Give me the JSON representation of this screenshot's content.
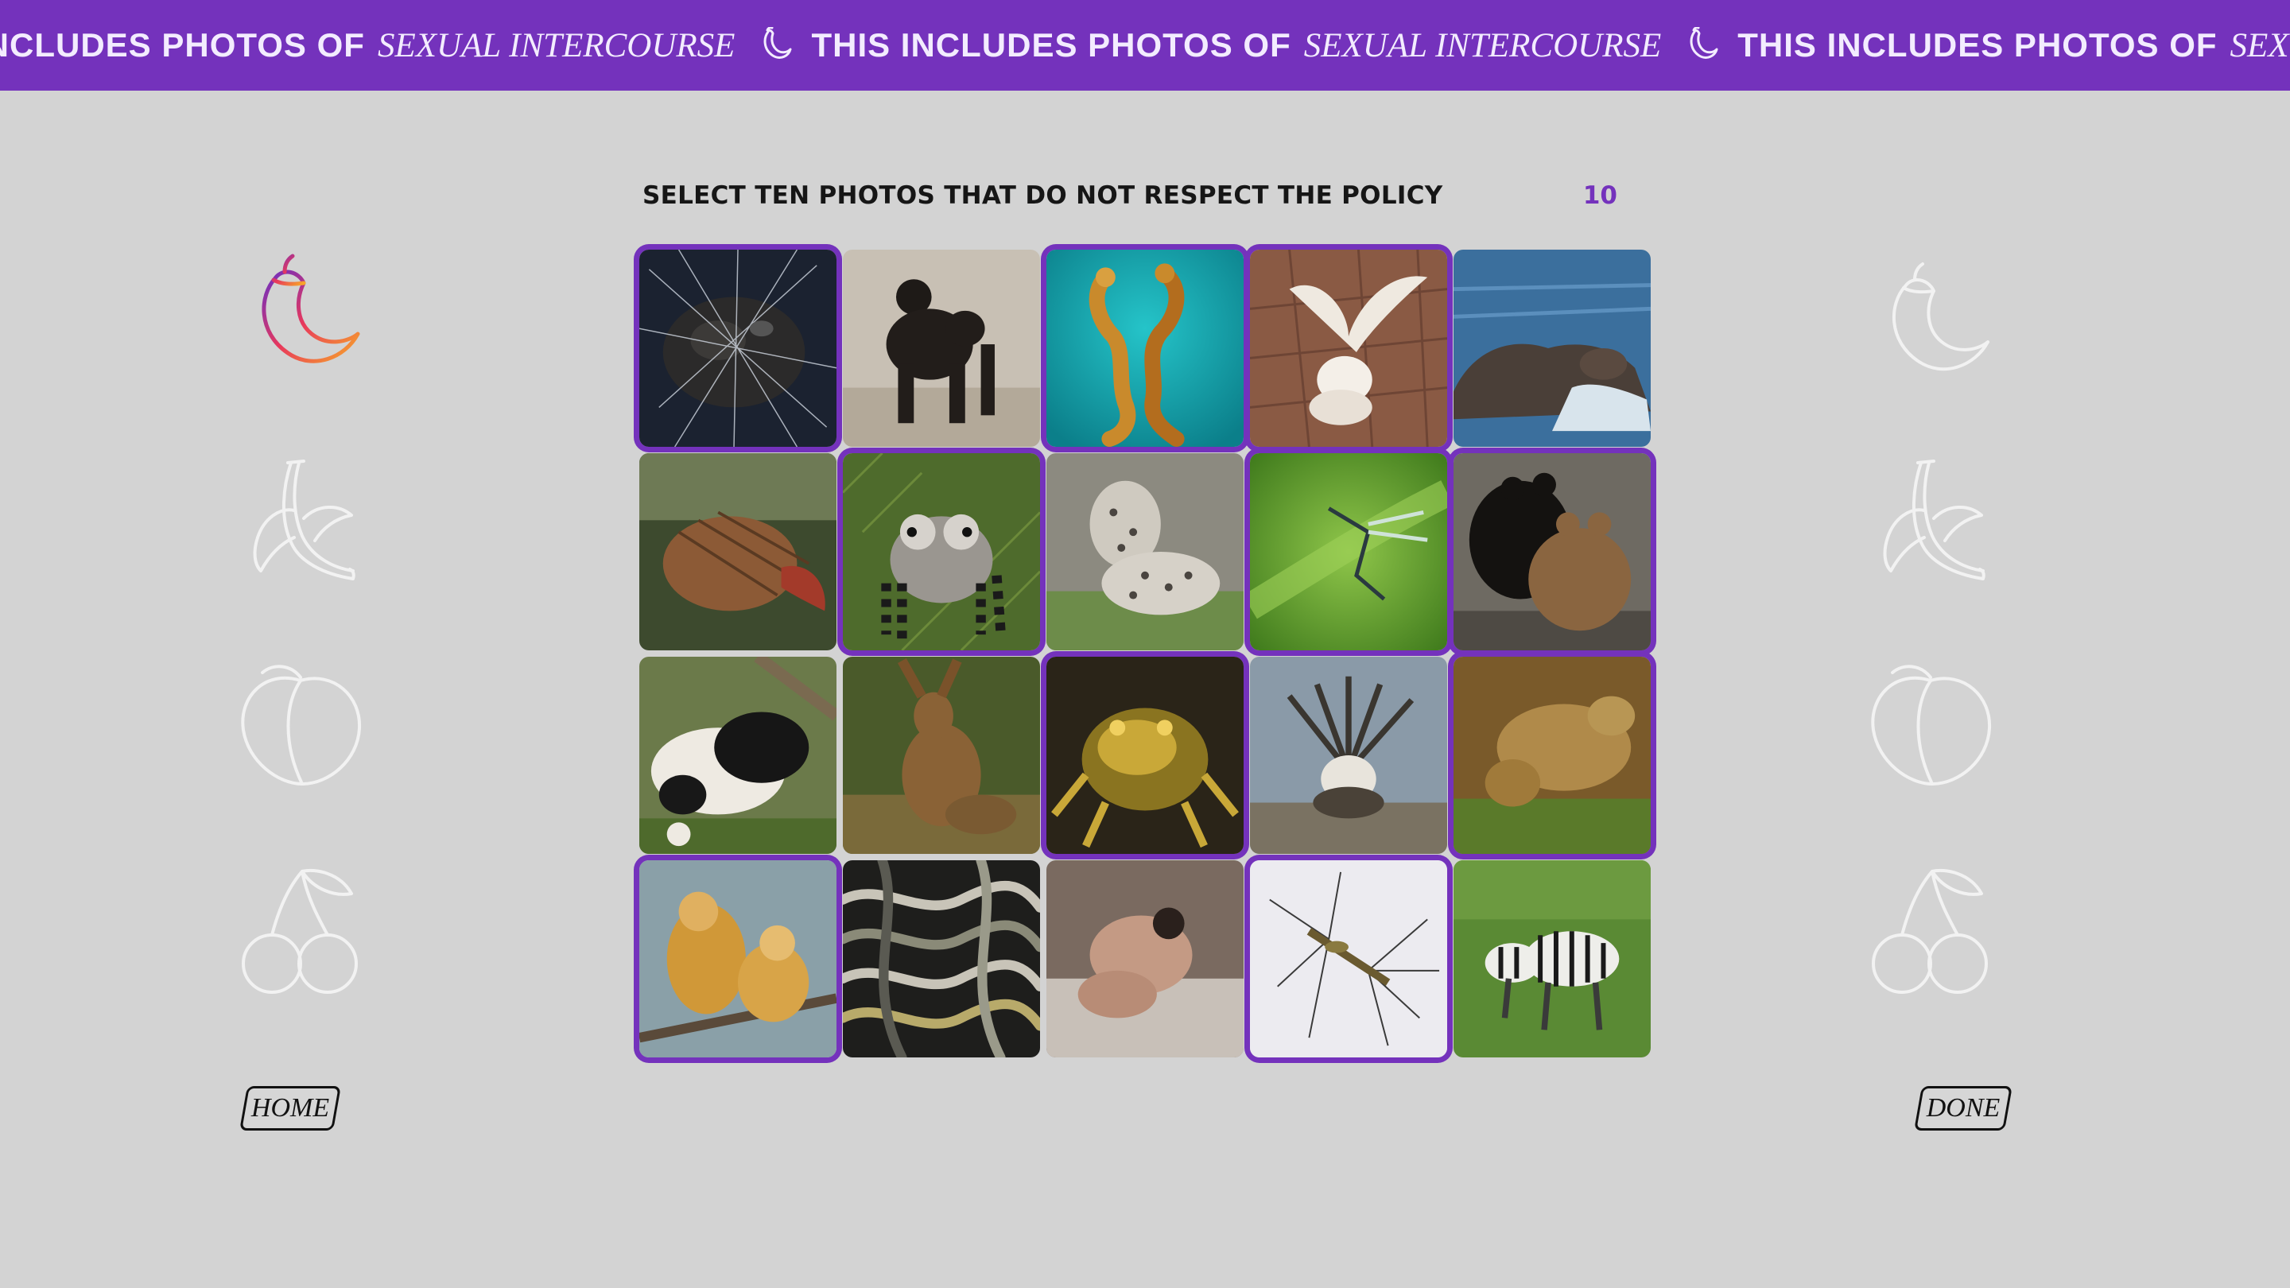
{
  "banner": {
    "first_fragment": "INCLUDES PHOTOS OF",
    "bold_text": "THIS INCLUDES PHOTOS OF",
    "italic_text": "SEXUAL INTERCOURSE",
    "last_fragment_bold": "THIS INCLUDES PHOTOS OF",
    "last_fragment_italic": "SEX",
    "separator_icon": "eggplant-icon"
  },
  "heading": {
    "instruction": "SELECT TEN PHOTOS THAT DO NOT RESPECT THE POLICY",
    "count": "10"
  },
  "grid": {
    "rows": 4,
    "columns": 5,
    "selected_count": 10,
    "photos": [
      {
        "subject": "anglerfish",
        "selected": true
      },
      {
        "subject": "chimpanzees",
        "selected": false
      },
      {
        "subject": "seahorses",
        "selected": true
      },
      {
        "subject": "white birds",
        "selected": true
      },
      {
        "subject": "walruses",
        "selected": false
      },
      {
        "subject": "fish underwater",
        "selected": false
      },
      {
        "subject": "ring-tailed lemurs",
        "selected": true
      },
      {
        "subject": "snow leopards",
        "selected": false
      },
      {
        "subject": "damselflies",
        "selected": true
      },
      {
        "subject": "bears",
        "selected": true
      },
      {
        "subject": "pandas",
        "selected": false
      },
      {
        "subject": "hares",
        "selected": false
      },
      {
        "subject": "frogs",
        "selected": true
      },
      {
        "subject": "sage grouse",
        "selected": false
      },
      {
        "subject": "monkeys on grass",
        "selected": true
      },
      {
        "subject": "golden snub-nosed monkeys",
        "selected": true
      },
      {
        "subject": "garter snakes",
        "selected": false
      },
      {
        "subject": "humans",
        "selected": false
      },
      {
        "subject": "crane flies",
        "selected": true
      },
      {
        "subject": "zebras",
        "selected": false
      }
    ]
  },
  "left_icons": [
    "eggplant-gradient-icon",
    "banana-icon",
    "peach-icon",
    "cherry-icon"
  ],
  "right_icons": [
    "eggplant-icon",
    "banana-icon",
    "peach-icon",
    "cherry-icon"
  ],
  "buttons": {
    "home_label": "HOME",
    "done_label": "DONE"
  },
  "colors": {
    "accent": "#7432bc",
    "background": "#d3d3d3",
    "icon_outline": "#f2f2f2",
    "gradient_start": "#6a2fc4",
    "gradient_mid": "#e8385c",
    "gradient_end": "#f7a928"
  }
}
